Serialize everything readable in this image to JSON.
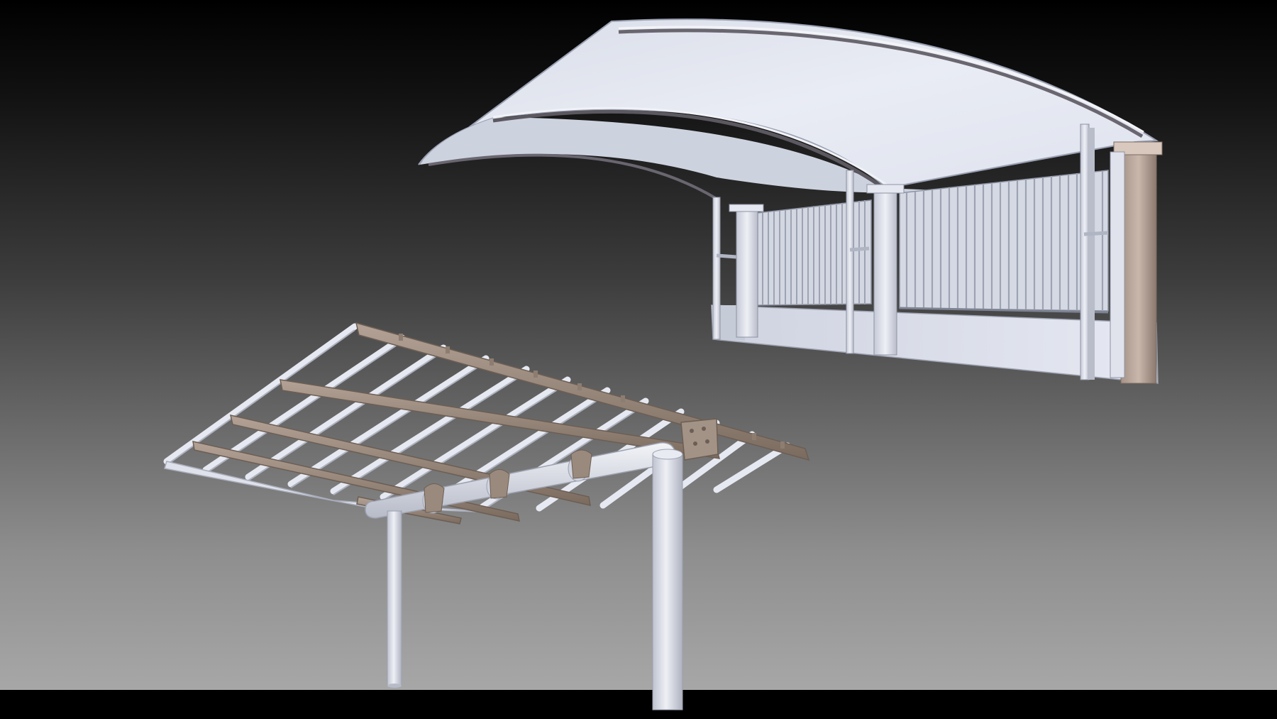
{
  "scene": {
    "description_kind": "3d-render",
    "objects": [
      {
        "id": "curved-canopy-shelter",
        "label": ""
      },
      {
        "id": "slatted-pergola-canopy",
        "label": ""
      }
    ]
  },
  "colors": {
    "background_top": "#000000",
    "background_bottom": "#a7a7a7",
    "canopy_white": "#e8ebf3",
    "canopy_shade": "#c3c8d6",
    "brown_beam": "#8a7a6b",
    "brown_beam_light": "#a8978a",
    "post_white": "#dadee8"
  }
}
